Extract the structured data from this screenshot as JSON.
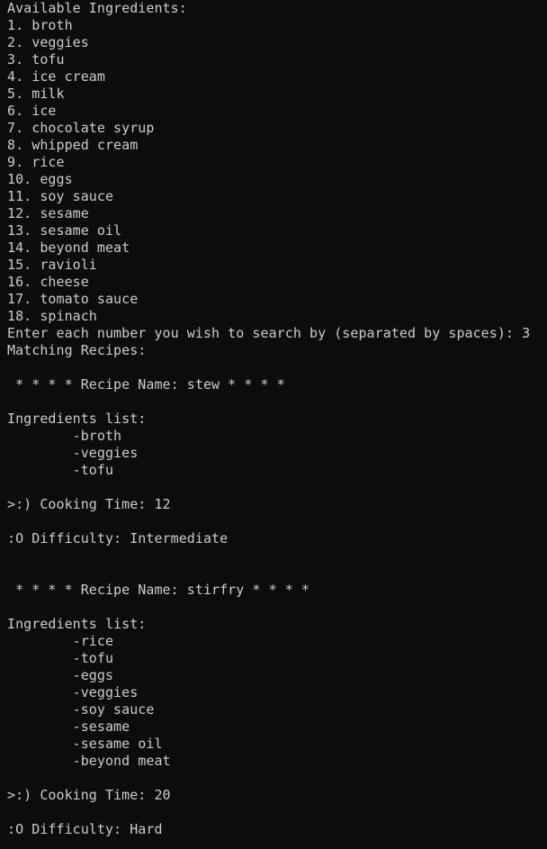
{
  "colors": {
    "background": "#0c0c0c",
    "text": "#cccccc"
  },
  "terminal": {
    "lines": [
      "Available Ingredients:",
      "1. broth",
      "2. veggies",
      "3. tofu",
      "4. ice cream",
      "5. milk",
      "6. ice",
      "7. chocolate syrup",
      "8. whipped cream",
      "9. rice",
      "10. eggs",
      "11. soy sauce",
      "12. sesame",
      "13. sesame oil",
      "14. beyond meat",
      "15. ravioli",
      "16. cheese",
      "17. tomato sauce",
      "18. spinach",
      "Enter each number you wish to search by (separated by spaces): 3",
      "Matching Recipes:",
      "",
      " * * * * Recipe Name: stew * * * *",
      "",
      "Ingredients list:",
      "        -broth",
      "        -veggies",
      "        -tofu",
      "",
      ">:) Cooking Time: 12",
      "",
      ":O Difficulty: Intermediate",
      "",
      "",
      " * * * * Recipe Name: stirfry * * * *",
      "",
      "Ingredients list:",
      "        -rice",
      "        -tofu",
      "        -eggs",
      "        -veggies",
      "        -soy sauce",
      "        -sesame",
      "        -sesame oil",
      "        -beyond meat",
      "",
      ">:) Cooking Time: 20",
      "",
      ":O Difficulty: Hard"
    ]
  }
}
